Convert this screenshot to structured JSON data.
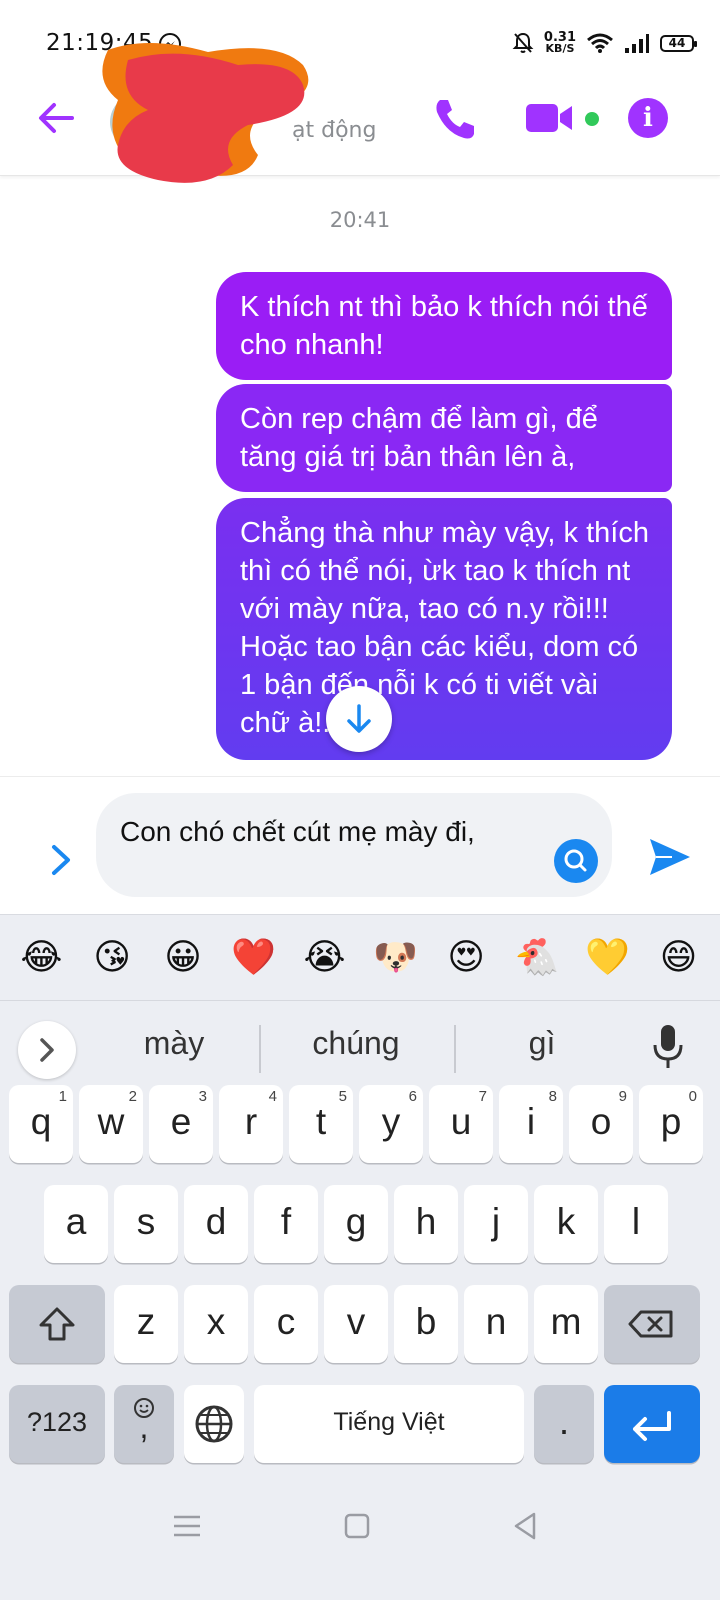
{
  "status_bar": {
    "time": "21:19:45",
    "net_speed": "0.31",
    "net_unit": "KB/S",
    "battery": "44"
  },
  "header": {
    "status_text": "ạt động"
  },
  "chat": {
    "timestamp": "20:41",
    "messages": [
      "K thích nt thì bảo k thích nói thế cho nhanh!",
      "Còn rep chậm để làm gì, để tăng giá trị bản thân lên à,",
      "Chẳng thà như mày vậy, k thích thì có thể nói, ừk tao k thích nt với mày nữa,  tao có n.y rồi!!! Hoặc tao bận các kiểu, dom có 1 bận  đến nỗi k có ti    viết vài chữ à!....."
    ]
  },
  "composer": {
    "input_value": " Con chó chết  cút mẹ mày đi,"
  },
  "keyboard": {
    "emojis": [
      "😂",
      "😘",
      "😀",
      "❤️",
      "😭",
      "🐶",
      "😍",
      "🐔",
      "💛",
      "😄"
    ],
    "suggestions": [
      "mày",
      "chúng",
      "gì"
    ],
    "row1": [
      "q",
      "w",
      "e",
      "r",
      "t",
      "y",
      "u",
      "i",
      "o",
      "p"
    ],
    "row1_hints": [
      "1",
      "2",
      "3",
      "4",
      "5",
      "6",
      "7",
      "8",
      "9",
      "0"
    ],
    "row2": [
      "a",
      "s",
      "d",
      "f",
      "g",
      "h",
      "j",
      "k",
      "l"
    ],
    "row3": [
      "z",
      "x",
      "c",
      "v",
      "b",
      "n",
      "m"
    ],
    "symbols_label": "?123",
    "comma_label": ",",
    "space_label": "Tiếng Việt",
    "period_label": "."
  },
  "colors": {
    "accent": "#a033ff",
    "send_blue": "#1a88f0",
    "online": "#31c95a",
    "keyboard_bg": "#eceef3"
  },
  "icons": [
    "messenger-icon",
    "mute-bell-icon",
    "wifi-icon",
    "signal-icon",
    "battery-icon",
    "back-arrow-icon",
    "phone-icon",
    "video-icon",
    "info-icon",
    "chevron-right-icon",
    "search-icon",
    "send-icon",
    "arrow-down-icon",
    "chevron-right-icon",
    "mic-icon",
    "shift-icon",
    "backspace-icon",
    "emoji-icon",
    "globe-icon",
    "enter-icon",
    "menu-icon",
    "home-icon",
    "back-icon"
  ]
}
